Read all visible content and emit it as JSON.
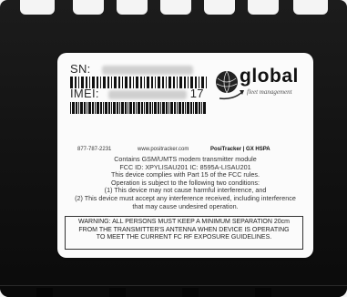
{
  "label": {
    "sn_prefix": "SN:",
    "imei_prefix": "IMEI:",
    "imei_suffix": "17",
    "brand_name": "global",
    "brand_tagline": "fleet management",
    "phone": "877-787-2231",
    "website": "www.positracker.com",
    "product": "PosiTracker | GX HSPA",
    "body_lines": [
      "Contains GSM/UMTS modem transmitter module",
      "FCC ID: XPYLISAU201    IC: 8595A-LISAU201",
      "This device complies with Part 15 of the FCC rules.",
      "Operation is subject to the following two conditions:",
      "(1) This device may not cause harmful interference, and",
      "(2) This device must accept any interference received, including interference",
      "that may cause undesired operation."
    ],
    "warning_lines": [
      "WARNING: ALL PERSONS MUST KEEP A MINIMUM SEPARATION 20cm",
      "FROM THE TRANSMITTER'S ANTENNA WHEN DEVICE IS OPERATING",
      "TO MEET THE CURRENT FC    RF EXPOSURE GUIDELINES."
    ]
  },
  "colors": {
    "device_body": "#151515",
    "label_background": "#fbfbfb",
    "text": "#333333"
  }
}
